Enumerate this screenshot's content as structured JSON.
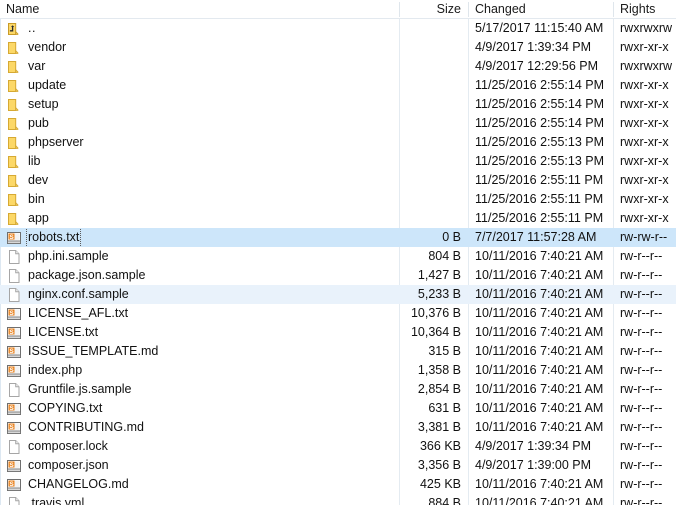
{
  "panel": {
    "type": "file-listing",
    "columns": [
      {
        "key": "name",
        "label": "Name",
        "align": "left"
      },
      {
        "key": "size",
        "label": "Size",
        "align": "right"
      },
      {
        "key": "changed",
        "label": "Changed",
        "align": "left"
      },
      {
        "key": "rights",
        "label": "Rights",
        "align": "left"
      }
    ],
    "colors": {
      "selection": "#cde6fa",
      "alternate_row": "#e9f2fb",
      "grid_line": "#e4ebf1",
      "folder_icon": "#fcd867",
      "text": "#111111"
    },
    "rows": [
      {
        "icon": "folder-up-icon",
        "name": "..",
        "size": "",
        "changed": "5/17/2017 11:15:40 AM",
        "rights": "rwxrwxrw",
        "selected": false,
        "alt": false,
        "focused": false,
        "partial": false
      },
      {
        "icon": "folder-icon",
        "name": "vendor",
        "size": "",
        "changed": "4/9/2017 1:39:34 PM",
        "rights": "rwxr-xr-x",
        "selected": false,
        "alt": false,
        "focused": false,
        "partial": false
      },
      {
        "icon": "folder-icon",
        "name": "var",
        "size": "",
        "changed": "4/9/2017 12:29:56 PM",
        "rights": "rwxrwxrw",
        "selected": false,
        "alt": false,
        "focused": false,
        "partial": false
      },
      {
        "icon": "folder-icon",
        "name": "update",
        "size": "",
        "changed": "11/25/2016 2:55:14 PM",
        "rights": "rwxr-xr-x",
        "selected": false,
        "alt": false,
        "focused": false,
        "partial": false
      },
      {
        "icon": "folder-icon",
        "name": "setup",
        "size": "",
        "changed": "11/25/2016 2:55:14 PM",
        "rights": "rwxr-xr-x",
        "selected": false,
        "alt": false,
        "focused": false,
        "partial": false
      },
      {
        "icon": "folder-icon",
        "name": "pub",
        "size": "",
        "changed": "11/25/2016 2:55:14 PM",
        "rights": "rwxr-xr-x",
        "selected": false,
        "alt": false,
        "focused": false,
        "partial": false
      },
      {
        "icon": "folder-icon",
        "name": "phpserver",
        "size": "",
        "changed": "11/25/2016 2:55:13 PM",
        "rights": "rwxr-xr-x",
        "selected": false,
        "alt": false,
        "focused": false,
        "partial": false
      },
      {
        "icon": "folder-icon",
        "name": "lib",
        "size": "",
        "changed": "11/25/2016 2:55:13 PM",
        "rights": "rwxr-xr-x",
        "selected": false,
        "alt": false,
        "focused": false,
        "partial": false
      },
      {
        "icon": "folder-icon",
        "name": "dev",
        "size": "",
        "changed": "11/25/2016 2:55:11 PM",
        "rights": "rwxr-xr-x",
        "selected": false,
        "alt": false,
        "focused": false,
        "partial": false
      },
      {
        "icon": "folder-icon",
        "name": "bin",
        "size": "",
        "changed": "11/25/2016 2:55:11 PM",
        "rights": "rwxr-xr-x",
        "selected": false,
        "alt": false,
        "focused": false,
        "partial": false
      },
      {
        "icon": "folder-icon",
        "name": "app",
        "size": "",
        "changed": "11/25/2016 2:55:11 PM",
        "rights": "rwxr-xr-x",
        "selected": false,
        "alt": false,
        "focused": false,
        "partial": false
      },
      {
        "icon": "text-file-icon",
        "name": "robots.txt",
        "size": "0 B",
        "changed": "7/7/2017 11:57:28 AM",
        "rights": "rw-rw-r--",
        "selected": true,
        "alt": false,
        "focused": true,
        "partial": false
      },
      {
        "icon": "blank-file-icon",
        "name": "php.ini.sample",
        "size": "804 B",
        "changed": "10/11/2016 7:40:21 AM",
        "rights": "rw-r--r--",
        "selected": false,
        "alt": false,
        "focused": false,
        "partial": false
      },
      {
        "icon": "blank-file-icon",
        "name": "package.json.sample",
        "size": "1,427 B",
        "changed": "10/11/2016 7:40:21 AM",
        "rights": "rw-r--r--",
        "selected": false,
        "alt": false,
        "focused": false,
        "partial": false
      },
      {
        "icon": "blank-file-icon",
        "name": "nginx.conf.sample",
        "size": "5,233 B",
        "changed": "10/11/2016 7:40:21 AM",
        "rights": "rw-r--r--",
        "selected": false,
        "alt": true,
        "focused": false,
        "partial": false
      },
      {
        "icon": "text-file-icon",
        "name": "LICENSE_AFL.txt",
        "size": "10,376 B",
        "changed": "10/11/2016 7:40:21 AM",
        "rights": "rw-r--r--",
        "selected": false,
        "alt": false,
        "focused": false,
        "partial": false
      },
      {
        "icon": "text-file-icon",
        "name": "LICENSE.txt",
        "size": "10,364 B",
        "changed": "10/11/2016 7:40:21 AM",
        "rights": "rw-r--r--",
        "selected": false,
        "alt": false,
        "focused": false,
        "partial": false
      },
      {
        "icon": "text-file-icon",
        "name": "ISSUE_TEMPLATE.md",
        "size": "315 B",
        "changed": "10/11/2016 7:40:21 AM",
        "rights": "rw-r--r--",
        "selected": false,
        "alt": false,
        "focused": false,
        "partial": false
      },
      {
        "icon": "text-file-icon",
        "name": "index.php",
        "size": "1,358 B",
        "changed": "10/11/2016 7:40:21 AM",
        "rights": "rw-r--r--",
        "selected": false,
        "alt": false,
        "focused": false,
        "partial": false
      },
      {
        "icon": "blank-file-icon",
        "name": "Gruntfile.js.sample",
        "size": "2,854 B",
        "changed": "10/11/2016 7:40:21 AM",
        "rights": "rw-r--r--",
        "selected": false,
        "alt": false,
        "focused": false,
        "partial": false
      },
      {
        "icon": "text-file-icon",
        "name": "COPYING.txt",
        "size": "631 B",
        "changed": "10/11/2016 7:40:21 AM",
        "rights": "rw-r--r--",
        "selected": false,
        "alt": false,
        "focused": false,
        "partial": false
      },
      {
        "icon": "text-file-icon",
        "name": "CONTRIBUTING.md",
        "size": "3,381 B",
        "changed": "10/11/2016 7:40:21 AM",
        "rights": "rw-r--r--",
        "selected": false,
        "alt": false,
        "focused": false,
        "partial": false
      },
      {
        "icon": "blank-file-icon",
        "name": "composer.lock",
        "size": "366 KB",
        "changed": "4/9/2017 1:39:34 PM",
        "rights": "rw-r--r--",
        "selected": false,
        "alt": false,
        "focused": false,
        "partial": false
      },
      {
        "icon": "text-file-icon",
        "name": "composer.json",
        "size": "3,356 B",
        "changed": "4/9/2017 1:39:00 PM",
        "rights": "rw-r--r--",
        "selected": false,
        "alt": false,
        "focused": false,
        "partial": false
      },
      {
        "icon": "text-file-icon",
        "name": "CHANGELOG.md",
        "size": "425 KB",
        "changed": "10/11/2016 7:40:21 AM",
        "rights": "rw-r--r--",
        "selected": false,
        "alt": false,
        "focused": false,
        "partial": false
      },
      {
        "icon": "blank-file-icon",
        "name": ".travis.yml",
        "size": "884 B",
        "changed": "10/11/2016 7:40:21 AM",
        "rights": "rw-r--r--",
        "selected": false,
        "alt": false,
        "focused": false,
        "partial": true
      }
    ]
  }
}
